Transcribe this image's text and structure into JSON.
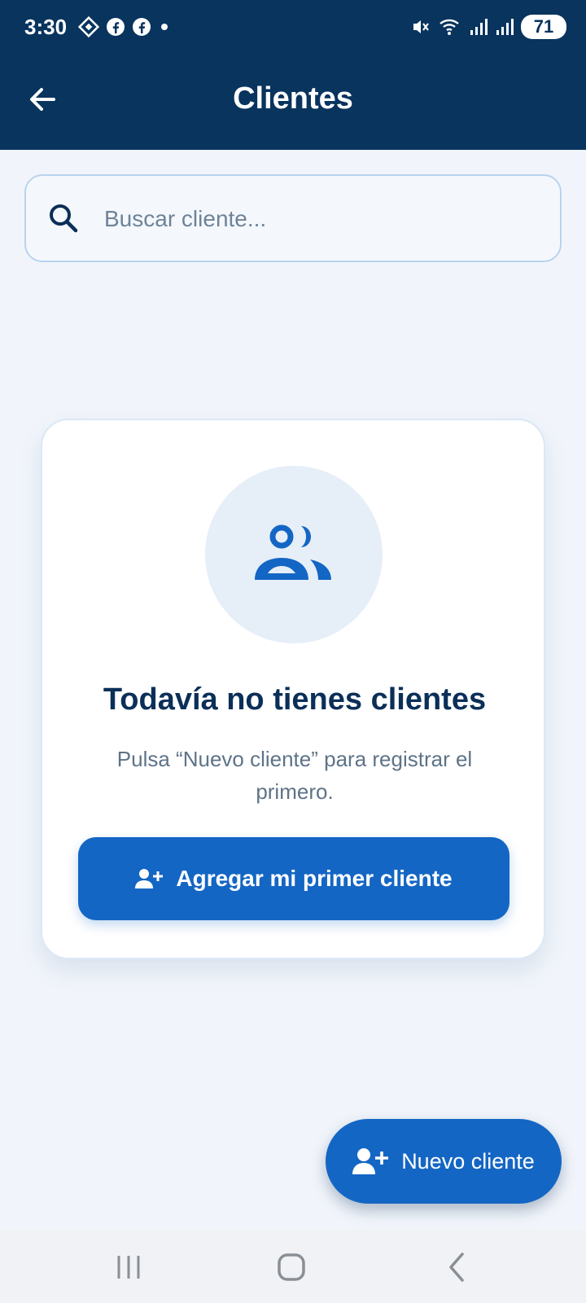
{
  "status_bar": {
    "time": "3:30",
    "left_icons": [
      "app-diamond-icon",
      "facebook-icon",
      "facebook-icon",
      "dot-icon"
    ],
    "right_icons": [
      "mute-icon",
      "wifi-icon",
      "signal-icon",
      "signal-icon"
    ],
    "battery": "71"
  },
  "header": {
    "title": "Clientes",
    "back_icon": "arrow-left-icon"
  },
  "search": {
    "placeholder": "Buscar cliente...",
    "value": ""
  },
  "empty_state": {
    "icon": "people-icon",
    "title": "Todavía no tienes clientes",
    "description": "Pulsa “Nuevo cliente” para registrar el primero.",
    "button_label": "Agregar mi primer cliente",
    "button_icon": "person-add-icon"
  },
  "fab": {
    "label": "Nuevo cliente",
    "icon": "person-add-icon"
  },
  "nav_bar": {
    "items": [
      "recent-apps-icon",
      "home-icon",
      "back-icon"
    ]
  },
  "colors": {
    "header_bg": "#08345e",
    "page_bg": "#f1f5fb",
    "primary": "#1466c4",
    "title_text": "#0b2f58",
    "muted_text": "#5e7387"
  }
}
